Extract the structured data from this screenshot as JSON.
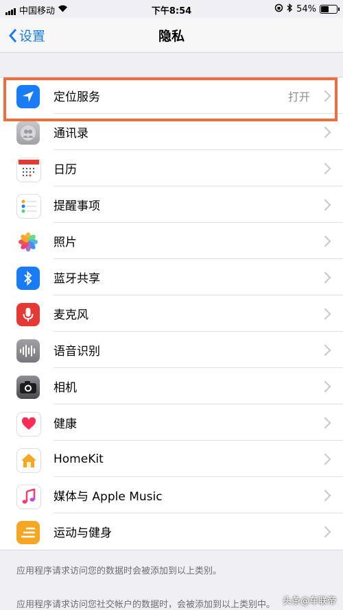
{
  "status_bar": {
    "carrier": "中国移动",
    "time": "下午8:54",
    "battery": "54%"
  },
  "nav": {
    "back_label": "设置",
    "title": "隐私"
  },
  "rows": [
    {
      "label": "定位服务",
      "value": "打开",
      "icon": "location-arrow-icon",
      "color": "#1a7cf5"
    },
    {
      "label": "通讯录",
      "value": "",
      "icon": "contacts-icon",
      "color": "#b0b0b5"
    },
    {
      "label": "日历",
      "value": "",
      "icon": "calendar-icon",
      "color": "#ffffff"
    },
    {
      "label": "提醒事项",
      "value": "",
      "icon": "reminders-icon",
      "color": "#ffffff"
    },
    {
      "label": "照片",
      "value": "",
      "icon": "photos-icon",
      "color": "#ffffff"
    },
    {
      "label": "蓝牙共享",
      "value": "",
      "icon": "bluetooth-icon",
      "color": "#1a7cf5"
    },
    {
      "label": "麦克风",
      "value": "",
      "icon": "microphone-icon",
      "color": "#e53935"
    },
    {
      "label": "语音识别",
      "value": "",
      "icon": "speech-waveform-icon",
      "color": "#8e8e93"
    },
    {
      "label": "相机",
      "value": "",
      "icon": "camera-icon",
      "color": "#5a5a5e"
    },
    {
      "label": "健康",
      "value": "",
      "icon": "heart-icon",
      "color": "#ffffff"
    },
    {
      "label": "HomeKit",
      "value": "",
      "icon": "home-icon",
      "color": "#ffffff"
    },
    {
      "label": "媒体与 Apple Music",
      "value": "",
      "icon": "music-note-icon",
      "color": "#ffffff"
    },
    {
      "label": "运动与健身",
      "value": "",
      "icon": "motion-fitness-icon",
      "color": "#f5a623"
    }
  ],
  "footer": {
    "note1": "应用程序请求访问您的数据时会被添加到以上类别。",
    "note2": "应用程序请求访问您社交帐户的数据时，会被添加到以上类别中。"
  },
  "watermark": "头条@车联帝",
  "accent_color": "#1a7cf5",
  "highlight_color": "#f06d3d"
}
